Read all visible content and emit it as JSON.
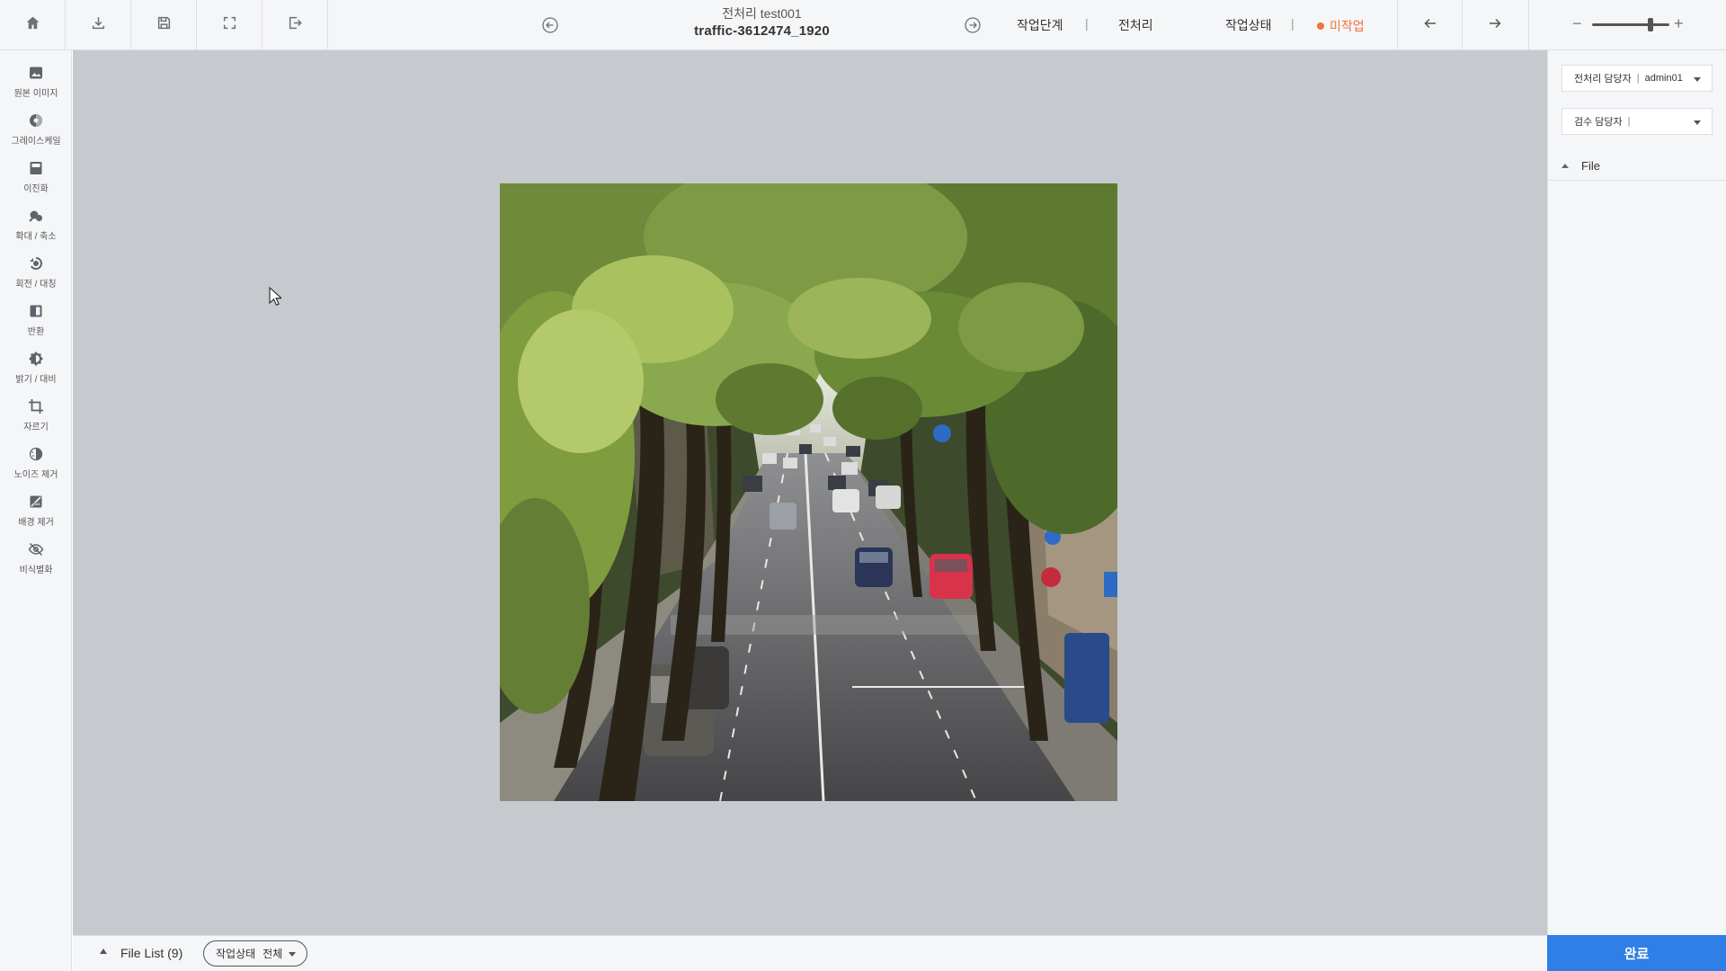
{
  "header": {
    "icons": [
      "home-icon",
      "download-icon",
      "save-icon",
      "fullscreen-icon",
      "exit-icon"
    ],
    "subtitle": "전처리 test001",
    "title": "traffic-3612474_1920",
    "stage_label": "작업단계",
    "stage_value": "전처리",
    "status_label": "작업상태",
    "status_value": "미작업",
    "divider": "|",
    "zoom_minus": "−",
    "zoom_plus": "+",
    "zoom_level": 0.75
  },
  "sidebar": {
    "tools": [
      {
        "label": "원본 이미지",
        "icon": "original-image-icon"
      },
      {
        "label": "그레이스케일",
        "icon": "grayscale-icon"
      },
      {
        "label": "이진화",
        "icon": "binarize-icon"
      },
      {
        "label": "확대 / 축소",
        "icon": "resize-icon"
      },
      {
        "label": "회전 / 대칭",
        "icon": "rotate-icon"
      },
      {
        "label": "반환",
        "icon": "invert-icon"
      },
      {
        "label": "밝기 / 대비",
        "icon": "brightness-icon"
      },
      {
        "label": "자르기",
        "icon": "crop-icon"
      },
      {
        "label": "노이즈 제거",
        "icon": "denoise-icon"
      },
      {
        "label": "배경 제거",
        "icon": "background-remove-icon"
      },
      {
        "label": "비식별화",
        "icon": "deidentify-icon"
      }
    ]
  },
  "bottom": {
    "file_list_label": "File List (9)",
    "filter_label": "작업상태",
    "filter_value": "전체"
  },
  "right_panel": {
    "preprocess_owner_label": "전처리 담당자",
    "preprocess_owner_value": "admin01",
    "review_owner_label": "검수 담당자",
    "review_owner_value": "",
    "file_section_label": "File",
    "complete_label": "완료"
  },
  "colors": {
    "accent": "#2f7fe6",
    "status": "#f0723a",
    "canvas": "#c6cacf",
    "panel": "#f5f6f8"
  }
}
